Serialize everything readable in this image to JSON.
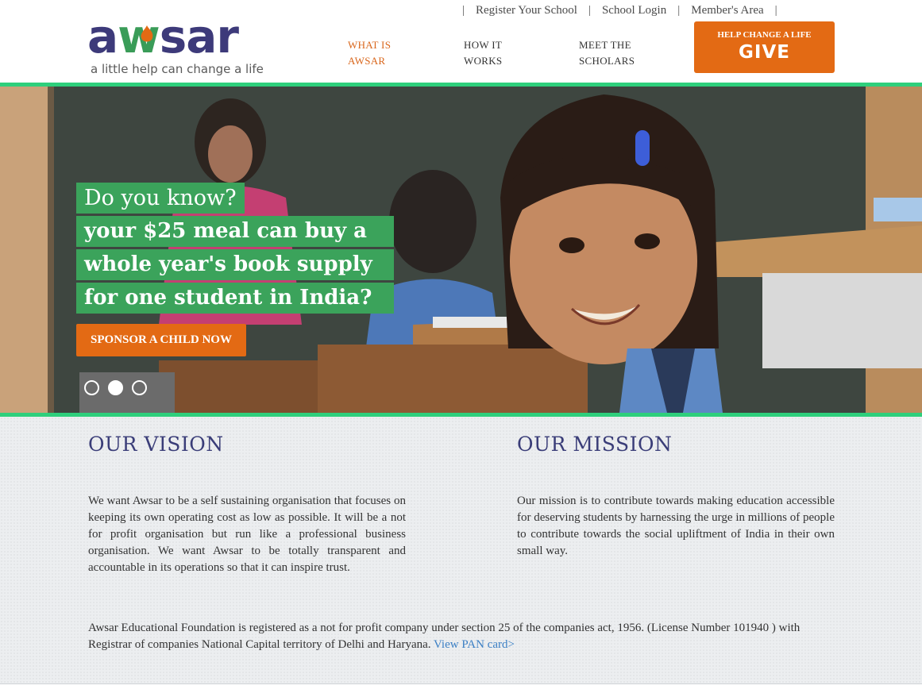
{
  "brand": {
    "logo_text_a": "a",
    "logo_text_w": "w",
    "logo_text_sar": "sar",
    "tagline": "a little help can change a life",
    "colors": {
      "primary_purple": "#3d3a7a",
      "green": "#3a9c58",
      "orange": "#e36a14",
      "accent_stripe": "#2ecf7c",
      "link_blue": "#3b7fc4"
    }
  },
  "toplinks": {
    "separator": "|",
    "items": [
      {
        "label": "Register Your School"
      },
      {
        "label": "School Login"
      },
      {
        "label": "Member's Area"
      }
    ]
  },
  "nav": {
    "what_line1": "WHAT IS",
    "what_line2": "AWSAR",
    "how_line1": "HOW IT",
    "how_line2": "WORKS",
    "meet_line1": "MEET THE",
    "meet_line2": "SCHOLARS"
  },
  "give_button": {
    "small": "HELP CHANGE A LIFE",
    "big": "GIVE"
  },
  "hero": {
    "question": "Do you know?",
    "line1": "your $25 meal can buy a",
    "line2": "whole year's book supply",
    "line3": "for one student in India?",
    "cta": "SPONSOR A CHILD NOW",
    "slides": 3,
    "active_slide": 2
  },
  "vision": {
    "title": "OUR VISION",
    "text": "We want Awsar to be a self sustaining organisation that focuses on keeping its own operating cost as low as possible. It will be a not for profit organisation but run like a professional business organisation. We want Awsar to be totally transparent and accountable in its operations so that it can inspire trust."
  },
  "mission": {
    "title": "OUR MISSION",
    "text": "Our mission is to contribute towards making education accessible for deserving students by harnessing the urge in millions of people to contribute towards the social upliftment of India in their own small way."
  },
  "registration": {
    "text": "Awsar Educational Foundation is registered as a not for profit company under section 25 of the companies act, 1956. (License Number 101940 ) with Registrar of companies National Capital territory of Delhi and Haryana. ",
    "link": "View PAN card>"
  }
}
